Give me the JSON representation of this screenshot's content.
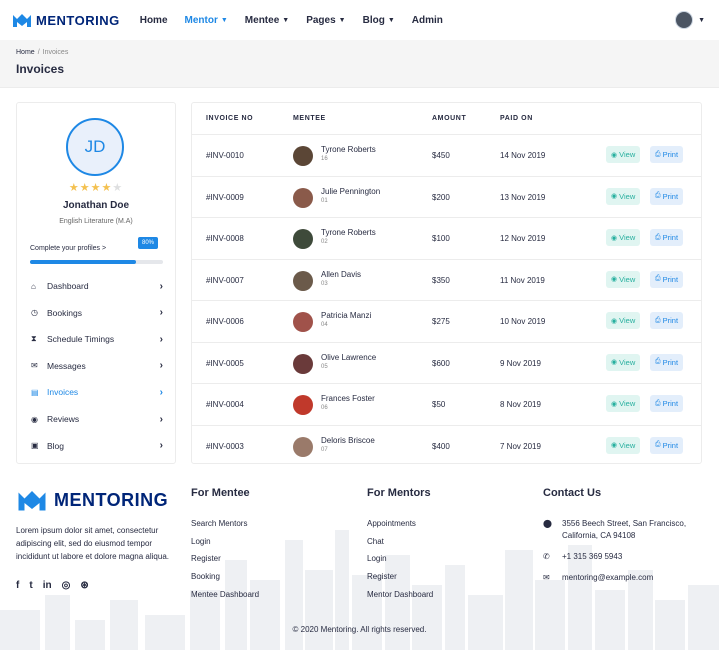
{
  "brand": {
    "name": "MENTORING",
    "accent": "#1e88e5",
    "dark": "#002578"
  },
  "nav": {
    "items": [
      {
        "label": "Home",
        "dropdown": false,
        "active": false
      },
      {
        "label": "Mentor",
        "dropdown": true,
        "active": true
      },
      {
        "label": "Mentee",
        "dropdown": true,
        "active": false
      },
      {
        "label": "Pages",
        "dropdown": true,
        "active": false
      },
      {
        "label": "Blog",
        "dropdown": true,
        "active": false
      },
      {
        "label": "Admin",
        "dropdown": false,
        "active": false
      }
    ]
  },
  "breadcrumb": {
    "home": "Home",
    "sep": "/",
    "current": "Invoices"
  },
  "page_title": "Invoices",
  "profile": {
    "initials": "JD",
    "rating": 4,
    "max_rating": 5,
    "name": "Jonathan Doe",
    "subject": "English Literature (M.A)",
    "complete_label": "Complete your profiles >",
    "progress_label": "80%",
    "progress": 0.8
  },
  "sidebar": {
    "items": [
      {
        "label": "Dashboard",
        "icon": "home-icon",
        "glyph": "⌂",
        "active": false
      },
      {
        "label": "Bookings",
        "icon": "clock-icon",
        "glyph": "◷",
        "active": false
      },
      {
        "label": "Schedule Timings",
        "icon": "hourglass-icon",
        "glyph": "⧗",
        "active": false
      },
      {
        "label": "Messages",
        "icon": "comments-icon",
        "glyph": "✉",
        "active": false
      },
      {
        "label": "Invoices",
        "icon": "file-invoice-icon",
        "glyph": "▤",
        "active": true
      },
      {
        "label": "Reviews",
        "icon": "eye-icon",
        "glyph": "◉",
        "active": false
      },
      {
        "label": "Blog",
        "icon": "blog-icon",
        "glyph": "▣",
        "active": false
      }
    ]
  },
  "table": {
    "headers": [
      "INVOICE NO",
      "MENTEE",
      "AMOUNT",
      "PAID ON"
    ],
    "view_label": "View",
    "print_label": "Print",
    "rows": [
      {
        "invoice": "#INV-0010",
        "name": "Tyrone Roberts",
        "id": "16",
        "amount": "$450",
        "date": "14 Nov 2019",
        "avatar": "#5b4636"
      },
      {
        "invoice": "#INV-0009",
        "name": "Julie Pennington",
        "id": "01",
        "amount": "$200",
        "date": "13 Nov 2019",
        "avatar": "#8a5a4a"
      },
      {
        "invoice": "#INV-0008",
        "name": "Tyrone Roberts",
        "id": "02",
        "amount": "$100",
        "date": "12 Nov 2019",
        "avatar": "#3e4a3a"
      },
      {
        "invoice": "#INV-0007",
        "name": "Allen Davis",
        "id": "03",
        "amount": "$350",
        "date": "11 Nov 2019",
        "avatar": "#6b5a4a"
      },
      {
        "invoice": "#INV-0006",
        "name": "Patricia Manzi",
        "id": "04",
        "amount": "$275",
        "date": "10 Nov 2019",
        "avatar": "#a0524a"
      },
      {
        "invoice": "#INV-0005",
        "name": "Olive Lawrence",
        "id": "05",
        "amount": "$600",
        "date": "9 Nov 2019",
        "avatar": "#6a3a3a"
      },
      {
        "invoice": "#INV-0004",
        "name": "Frances Foster",
        "id": "06",
        "amount": "$50",
        "date": "8 Nov 2019",
        "avatar": "#c0392b"
      },
      {
        "invoice": "#INV-0003",
        "name": "Deloris Briscoe",
        "id": "07",
        "amount": "$400",
        "date": "7 Nov 2019",
        "avatar": "#9a7a6a"
      }
    ]
  },
  "footer": {
    "brand": "MENTORING",
    "desc": "Lorem ipsum dolor sit amet, consectetur adipiscing elit, sed do eiusmod tempor incididunt ut labore et dolore magna aliqua.",
    "social": [
      {
        "icon": "facebook-icon",
        "glyph": "f"
      },
      {
        "icon": "twitter-icon",
        "glyph": "t"
      },
      {
        "icon": "linkedin-icon",
        "glyph": "in"
      },
      {
        "icon": "instagram-icon",
        "glyph": "◎"
      },
      {
        "icon": "dribbble-icon",
        "glyph": "⊛"
      }
    ],
    "mentee": {
      "title": "For Mentee",
      "links": [
        "Search Mentors",
        "Login",
        "Register",
        "Booking",
        "Mentee Dashboard"
      ]
    },
    "mentors": {
      "title": "For Mentors",
      "links": [
        "Appointments",
        "Chat",
        "Login",
        "Register",
        "Mentor Dashboard"
      ]
    },
    "contact": {
      "title": "Contact Us",
      "address_line1": "3556 Beech Street, San Francisco,",
      "address_line2": "California, CA 94108",
      "phone": "+1 315 369 5943",
      "email": "mentoring@example.com"
    },
    "copyright": "© 2020 Mentoring. All rights reserved."
  }
}
